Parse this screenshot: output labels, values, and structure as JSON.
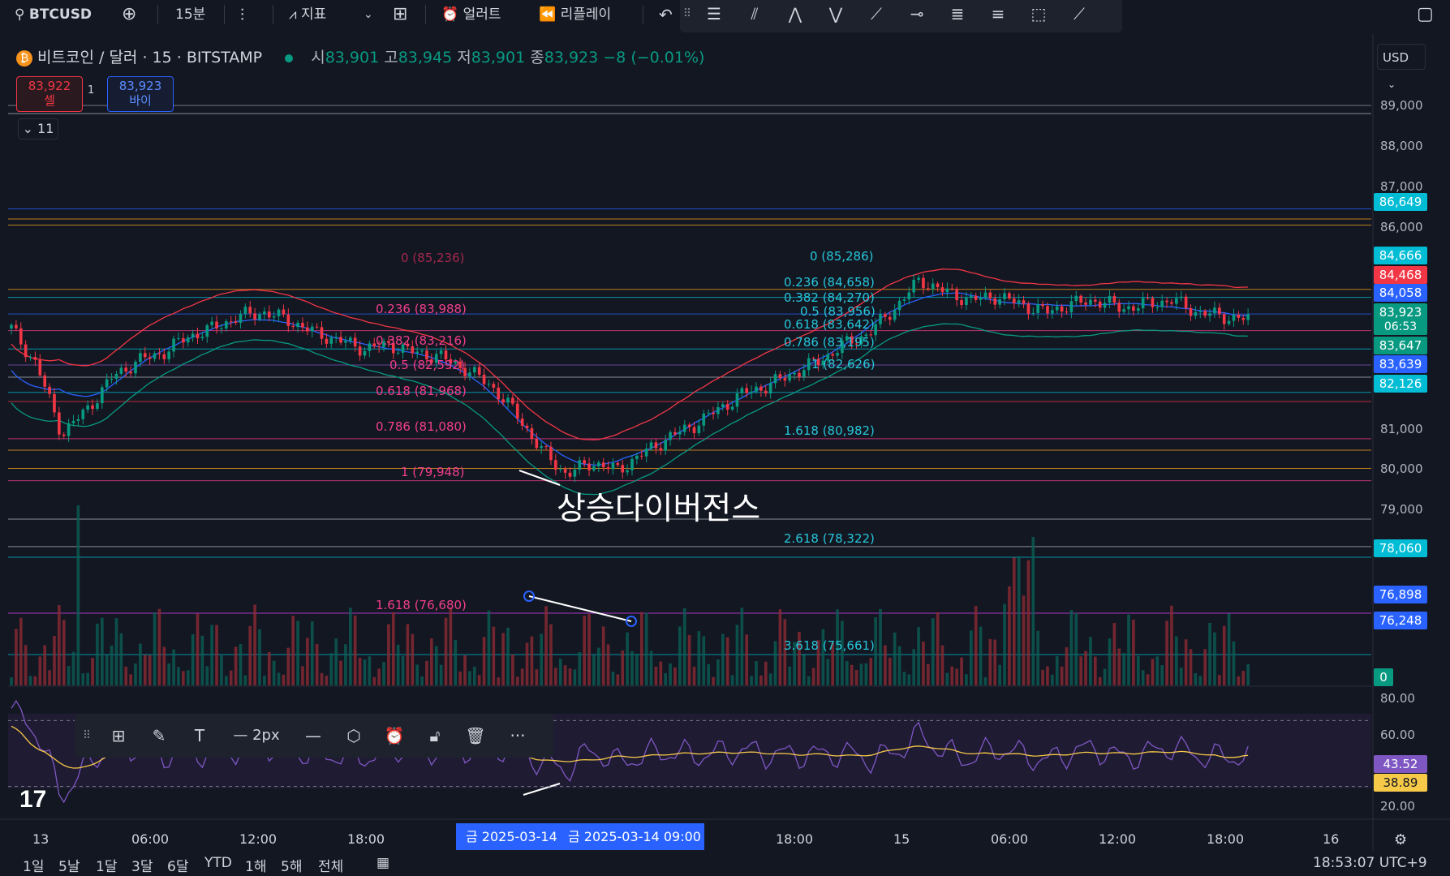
{
  "topbar": {
    "symbol": "BTCUSD",
    "interval": "15분",
    "indicators_label": "지표",
    "alert_label": "얼러트",
    "replay_label": "리플레이"
  },
  "legend": {
    "title": "비트코인 / 달러 · 15 · BITSTAMP",
    "o_label": "시",
    "o_value": "83,901",
    "h_label": "고",
    "h_value": "83,945",
    "l_label": "저",
    "l_value": "83,901",
    "c_label": "종",
    "c_value": "83,923",
    "change": "−8 (−0.01%)"
  },
  "trade": {
    "sell_price": "83,922",
    "sell_label": "셀",
    "buy_price": "83,923",
    "buy_label": "바이",
    "spread": "1"
  },
  "collapse_label": "⌄ 11",
  "currency": "USD",
  "annotation": "상승다이버전스",
  "price_axis": [
    "89,000",
    "88,000",
    "87,000",
    "86,000",
    "81,000",
    "80,000",
    "79,000"
  ],
  "price_tags": [
    {
      "text": "86,649",
      "color": "#00bcd4"
    },
    {
      "text": "84,666",
      "color": "#00bcd4"
    },
    {
      "text": "84,468",
      "color": "#f23645"
    },
    {
      "text": "84,058",
      "color": "#2962ff"
    },
    {
      "text": "83,923",
      "color": "#089981"
    },
    {
      "text": "06:53",
      "color": "#089981"
    },
    {
      "text": "83,647",
      "color": "#089981"
    },
    {
      "text": "83,639",
      "color": "#2962ff"
    },
    {
      "text": "82,126",
      "color": "#00bcd4"
    },
    {
      "text": "78,060",
      "color": "#00bcd4"
    },
    {
      "text": "76,898",
      "color": "#2962ff"
    },
    {
      "text": "76,248",
      "color": "#2962ff"
    },
    {
      "text": "0",
      "color": "#089981"
    }
  ],
  "fib_left": [
    {
      "text": "0 (85,236)"
    },
    {
      "text": "0.236 (83,988)"
    },
    {
      "text": "0.382 (83,216)"
    },
    {
      "text": "0.5 (82,592)"
    },
    {
      "text": "0.618 (81,968)"
    },
    {
      "text": "0.786 (81,080)"
    },
    {
      "text": "1 (79,948)"
    },
    {
      "text": "1.618 (76,680)"
    }
  ],
  "fib_right": [
    {
      "text": "0 (85,286)"
    },
    {
      "text": "0.236 (84,658)"
    },
    {
      "text": "0.382 (84,270)"
    },
    {
      "text": "0.5 (83,956)"
    },
    {
      "text": "0.618 (83,642)"
    },
    {
      "text": "0.786 (83,195)"
    },
    {
      "text": "1 (82,626)"
    },
    {
      "text": "1.618 (80,982)"
    },
    {
      "text": "2.618 (78,322)"
    },
    {
      "text": "3.618 (75,661)"
    }
  ],
  "rsi_axis": [
    "80.00",
    "60.00",
    "20.00"
  ],
  "rsi_tags": [
    {
      "text": "43.52",
      "color": "#7e57c2"
    },
    {
      "text": "38.89",
      "color": "#f7c948"
    }
  ],
  "time_axis": [
    "13",
    "06:00",
    "12:00",
    "18:00",
    "18:00",
    "15",
    "06:00",
    "12:00",
    "18:00",
    "16"
  ],
  "time_highlight": {
    "left": "금 2025-03-14",
    "right": "금 2025-03-14   09:00"
  },
  "drawbar": {
    "width_label": "2px"
  },
  "bottombar": {
    "ranges": [
      "1일",
      "5날",
      "1달",
      "3달",
      "6달",
      "YTD",
      "1해",
      "5해",
      "전체"
    ],
    "clock": "18:53:07 UTC+9"
  },
  "chart_data": {
    "type": "candlestick",
    "symbol": "BTCUSD",
    "price_range": [
      75000,
      89500
    ],
    "price_series_close": [
      83700,
      82800,
      81100,
      81700,
      82500,
      82900,
      83100,
      83500,
      83700,
      84000,
      84100,
      83900,
      83600,
      83400,
      83200,
      83300,
      83100,
      83000,
      82700,
      82300,
      81600,
      80700,
      80100,
      80400,
      80200,
      80600,
      81000,
      81300,
      81700,
      82100,
      82300,
      82600,
      82900,
      83300,
      83600,
      84200,
      84900,
      84600,
      84400,
      84500,
      84300,
      84100,
      84300,
      84400,
      84200,
      84300,
      84400,
      84100,
      84000,
      83923
    ],
    "rsi_range": [
      20,
      80
    ],
    "rsi_levels": [
      70,
      30
    ],
    "rsi_tag_values": [
      43.52,
      38.89
    ]
  }
}
